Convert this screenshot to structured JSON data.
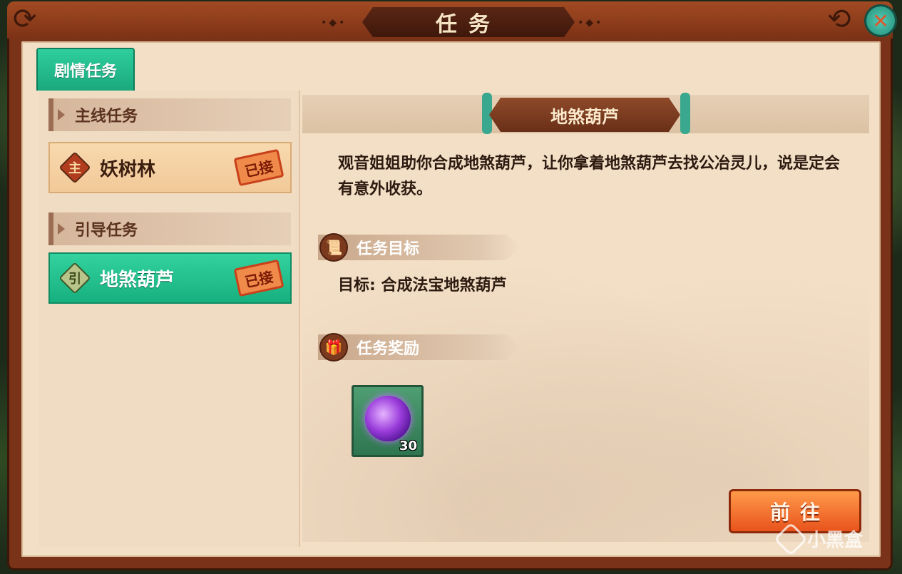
{
  "window": {
    "title": "任务"
  },
  "tabs": [
    {
      "label": "剧情任务"
    }
  ],
  "sidebar": {
    "sections": [
      {
        "header": "主线任务",
        "quest": {
          "badge": "主",
          "name": "妖树林",
          "status": "已接"
        }
      },
      {
        "header": "引导任务",
        "quest": {
          "badge": "引",
          "name": "地煞葫芦",
          "status": "已接"
        }
      }
    ]
  },
  "detail": {
    "title": "地煞葫芦",
    "description": "观音姐姐助你合成地煞葫芦，让你拿着地煞葫芦去找公冶灵儿，说是定会有意外收获。",
    "objective_header": "任务目标",
    "objective_text": "目标: 合成法宝地煞葫芦",
    "reward_header": "任务奖励",
    "reward": {
      "count": "30"
    },
    "go_button": "前往"
  },
  "watermark": "小黑盒",
  "colors": {
    "accent_green": "#1aa87c",
    "frame_brown": "#7a3318",
    "button_orange": "#e8531c"
  }
}
